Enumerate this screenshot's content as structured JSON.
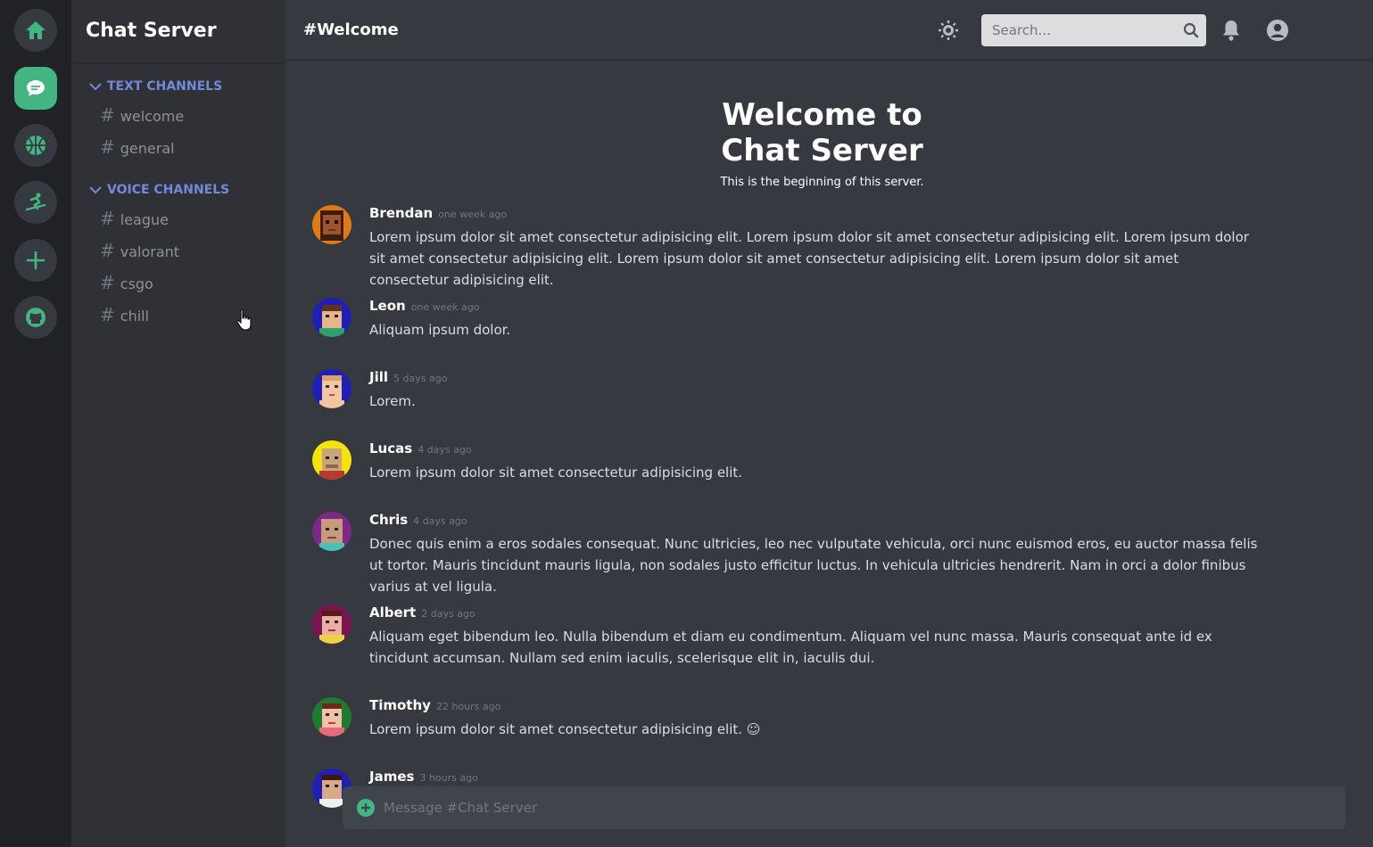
{
  "rail": {
    "servers": [
      {
        "name": "home-icon"
      },
      {
        "name": "chat-icon",
        "active": true
      },
      {
        "name": "basketball-icon"
      },
      {
        "name": "snowboard-icon"
      },
      {
        "name": "add-server-icon"
      },
      {
        "name": "github-icon"
      }
    ]
  },
  "sidebar": {
    "server_name": "Chat Server",
    "text_category": "TEXT CHANNELS",
    "text_channels": [
      "welcome",
      "general"
    ],
    "voice_category": "VOICE CHANNELS",
    "voice_channels": [
      "league",
      "valorant",
      "csgo",
      "chill"
    ]
  },
  "header": {
    "channel_title": "Welcome",
    "search_placeholder": "Search..."
  },
  "welcome": {
    "title_line1": "Welcome to",
    "title_line2": "Chat Server",
    "subtitle": "This is the beginning of this server."
  },
  "messages": [
    {
      "author": "Brendan",
      "time": "one week ago",
      "text": "Lorem ipsum dolor sit amet consectetur adipisicing elit. Lorem ipsum dolor sit amet consectetur adipisicing elit. Lorem ipsum dolor sit amet consectetur adipisicing elit. Lorem ipsum dolor sit amet consectetur adipisicing elit. Lorem ipsum dolor sit amet consectetur adipisicing elit."
    },
    {
      "author": "Leon",
      "time": "one week ago",
      "text": "Aliquam ipsum dolor."
    },
    {
      "author": "Jill",
      "time": "5 days ago",
      "text": "Lorem."
    },
    {
      "author": "Lucas",
      "time": "4 days ago",
      "text": "Lorem ipsum dolor sit amet consectetur adipisicing elit."
    },
    {
      "author": "Chris",
      "time": "4 days ago",
      "text": "Donec quis enim a eros sodales consequat. Nunc ultricies, leo nec vulputate vehicula, orci nunc euismod eros, eu auctor massa felis ut tortor. Mauris tincidunt mauris ligula, non sodales justo efficitur luctus. In vehicula ultricies hendrerit. Nam in orci a dolor finibus varius at vel ligula."
    },
    {
      "author": "Albert",
      "time": "2 days ago",
      "text": "Aliquam eget bibendum leo. Nulla bibendum et diam eu condimentum. Aliquam vel nunc massa. Mauris consequat ante id ex tincidunt accumsan. Nullam sed enim iaculis, scelerisque elit in, iaculis dui."
    },
    {
      "author": "Timothy",
      "time": "22 hours ago",
      "text": "Lorem ipsum dolor sit amet consectetur adipisicing elit. ☺"
    },
    {
      "author": "James",
      "time": "3 hours ago",
      "text": ""
    }
  ],
  "composer": {
    "placeholder": "Message #Chat Server"
  },
  "colors": {
    "accent_green": "#43b581",
    "category_blue": "#7289da"
  }
}
